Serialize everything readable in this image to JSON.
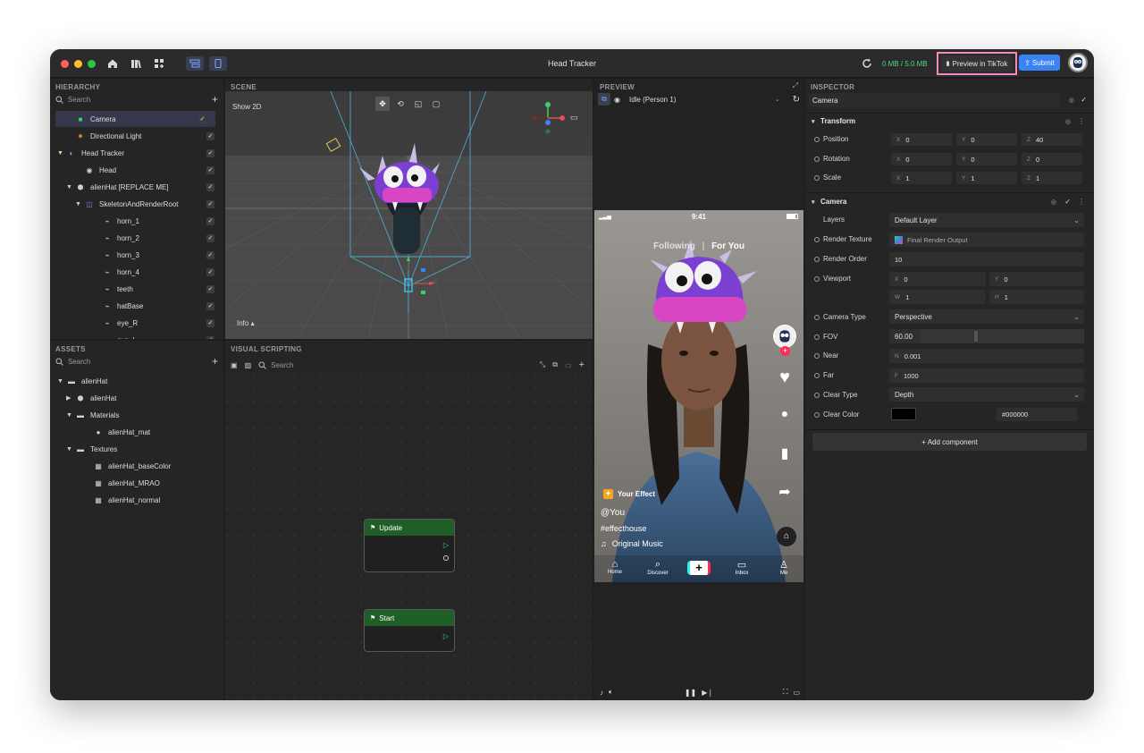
{
  "window": {
    "title": "Head Tracker",
    "storage": "0 MB / 5.0 MB",
    "preview_button": "Preview in TikTok",
    "submit_button": "Submit"
  },
  "hierarchy": {
    "header": "HIERARCHY",
    "search_placeholder": "Search",
    "items": [
      {
        "label": "Camera",
        "indent": 1,
        "icon": "camera-icon",
        "selected": true
      },
      {
        "label": "Directional Light",
        "indent": 1,
        "icon": "light-icon"
      },
      {
        "label": "Head Tracker",
        "indent": 0,
        "icon": "head-tracker-icon",
        "expanded": true
      },
      {
        "label": "Head",
        "indent": 2,
        "icon": "head-icon"
      },
      {
        "label": "alienHat [REPLACE ME]",
        "indent": 1,
        "icon": "model-icon",
        "expanded": true
      },
      {
        "label": "SkeletonAndRenderRoot",
        "indent": 2,
        "icon": "skeleton-icon",
        "expanded": true
      },
      {
        "label": "horn_1",
        "indent": 4,
        "icon": "bone-icon"
      },
      {
        "label": "horn_2",
        "indent": 4,
        "icon": "bone-icon"
      },
      {
        "label": "horn_3",
        "indent": 4,
        "icon": "bone-icon"
      },
      {
        "label": "horn_4",
        "indent": 4,
        "icon": "bone-icon"
      },
      {
        "label": "teeth",
        "indent": 4,
        "icon": "bone-icon"
      },
      {
        "label": "hatBase",
        "indent": 4,
        "icon": "bone-icon"
      },
      {
        "label": "eye_R",
        "indent": 4,
        "icon": "bone-icon"
      },
      {
        "label": "eye_L",
        "indent": 4,
        "icon": "bone-icon"
      }
    ]
  },
  "assets": {
    "header": "ASSETS",
    "search_placeholder": "Search",
    "items": [
      {
        "label": "alienHat",
        "indent": 0,
        "icon": "folder-icon",
        "expanded": true
      },
      {
        "label": "alienHat",
        "indent": 1,
        "icon": "model-icon",
        "collapsed": true
      },
      {
        "label": "Materials",
        "indent": 1,
        "icon": "folder-icon",
        "expanded": true
      },
      {
        "label": "alienHat_mat",
        "indent": 3,
        "icon": "material-icon"
      },
      {
        "label": "Textures",
        "indent": 1,
        "icon": "folder-icon",
        "expanded": true
      },
      {
        "label": "alienHat_baseColor",
        "indent": 3,
        "icon": "texture-icon"
      },
      {
        "label": "alienHat_MRAO",
        "indent": 3,
        "icon": "texture-icon"
      },
      {
        "label": "alienHat_normal",
        "indent": 3,
        "icon": "texture-icon"
      }
    ]
  },
  "scene": {
    "header": "SCENE",
    "show2d": "Show 2D",
    "info": "Info"
  },
  "visual_scripting": {
    "header": "VISUAL SCRIPTING",
    "search_placeholder": "Search",
    "nodes": [
      {
        "label": "Update"
      },
      {
        "label": "Start"
      }
    ]
  },
  "preview": {
    "header": "PREVIEW",
    "dropdown": "Idle (Person 1)",
    "phone": {
      "time": "9:41",
      "tab_following": "Following",
      "tab_for_you": "For You",
      "effect_label": "Your Effect",
      "user": "@You",
      "hashtag": "#effecthouse",
      "music": "Original Music",
      "nav": [
        "Home",
        "Discover",
        "Inbox",
        "Me"
      ]
    }
  },
  "inspector": {
    "header": "INSPECTOR",
    "object_name": "Camera",
    "transform": {
      "title": "Transform",
      "position": {
        "label": "Position",
        "x": "0",
        "y": "0",
        "z": "40"
      },
      "rotation": {
        "label": "Rotation",
        "x": "0",
        "y": "0",
        "z": "0"
      },
      "scale": {
        "label": "Scale",
        "x": "1",
        "y": "1",
        "z": "1"
      }
    },
    "camera": {
      "title": "Camera",
      "layers_label": "Layers",
      "layers_value": "Default Layer",
      "render_texture_label": "Render Texture",
      "render_texture_value": "Final Render Output",
      "render_order_label": "Render Order",
      "render_order_value": "10",
      "viewport_label": "Viewport",
      "viewport": {
        "x": "0",
        "y": "0",
        "w": "1",
        "h": "1"
      },
      "camera_type_label": "Camera Type",
      "camera_type_value": "Perspective",
      "fov_label": "FOV",
      "fov_value": "60.00",
      "near_label": "Near",
      "near_value": "0.001",
      "far_label": "Far",
      "far_value": "1000",
      "clear_type_label": "Clear Type",
      "clear_type_value": "Depth",
      "clear_color_label": "Clear Color",
      "clear_color_value": "#000000"
    },
    "add_component": "+ Add component"
  },
  "colors": {
    "accent_blue": "#3b82f6",
    "highlight_pink": "#f08bbf",
    "storage_green": "#4ade80",
    "node_header_green": "#1f5f27"
  }
}
